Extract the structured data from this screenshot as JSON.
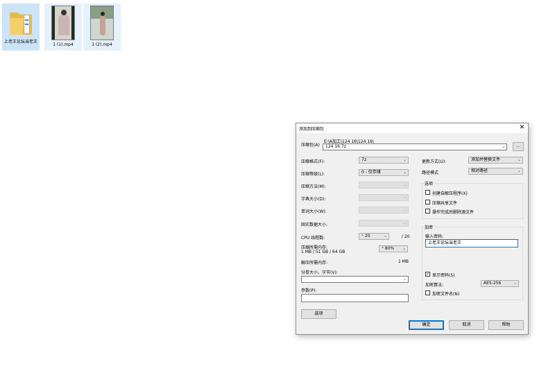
{
  "desktop": {
    "icons": [
      {
        "label": "上老王论坛当老王",
        "kind": "folder"
      },
      {
        "label": "1 (1).mp4",
        "kind": "video"
      },
      {
        "label": "1 (2).mp4",
        "kind": "video"
      }
    ]
  },
  "dialog": {
    "title": "添加到压缩包",
    "close_glyph": "✕",
    "archive_label": "压缩包(A)",
    "archive_path": "E:\\A加工\\124 16\\124 16\\",
    "archive_name": "124 16.7z",
    "browse_label": "...",
    "format_label": "压缩格式(F):",
    "format_value": "7z",
    "level_label": "压缩等级(L):",
    "level_value": "0 - 仅存储",
    "method_label": "压缩方法(M):",
    "dict_label": "字典大小(D):",
    "word_label": "单词大小(W):",
    "solid_label": "固实数据大小:",
    "cpu_label": "CPU 线程数:",
    "cpu_value": "20",
    "cpu_max": "/ 20",
    "mem_label": "压缩所需内存:",
    "mem_detail": "1 MB / 51 GB / 64 GB",
    "mem_value": "80%",
    "decomp_label": "解压所需内存:",
    "decomp_value": "1 MB",
    "split_label": "分卷大小，字节(V):",
    "params_label": "参数(P):",
    "options_button": "选项",
    "update_label": "更新方式(U):",
    "update_value": "添加并替换文件",
    "path_label": "路径模式",
    "path_value": "相对路径",
    "options_group": "选项",
    "opt_sfx": "创建自解压程序(X)",
    "opt_shared": "压缩共享文件",
    "opt_delete": "操作完成后删除源文件",
    "enc_group": "加密",
    "password_label": "输入密码:",
    "password_value": "上老王论坛当老王",
    "show_password": "显示密码(S)",
    "enc_method_label": "加密算法:",
    "enc_method_value": "AES-256",
    "enc_names": "加密文件名(N)",
    "ok_button": "确定",
    "cancel_button": "取消",
    "help_button": "帮助"
  }
}
